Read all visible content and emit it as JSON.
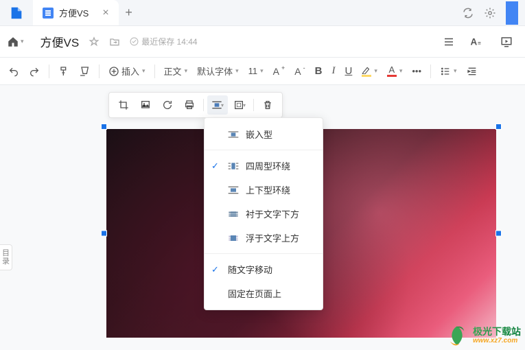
{
  "tab": {
    "title": "方便VS"
  },
  "header": {
    "doc_title": "方便VS",
    "save_status": "最近保存 14:44"
  },
  "toolbar": {
    "insert_label": "插入",
    "style_label": "正文",
    "font_label": "默认字体",
    "font_size": "11",
    "more": "•••"
  },
  "sidebar": {
    "outline": "目录"
  },
  "wrap_menu": {
    "items": [
      {
        "label": "嵌入型",
        "checked": false,
        "icon": "inline"
      },
      {
        "label": "四周型环绕",
        "checked": true,
        "icon": "square"
      },
      {
        "label": "上下型环绕",
        "checked": false,
        "icon": "topbottom"
      },
      {
        "label": "衬于文字下方",
        "checked": false,
        "icon": "behind"
      },
      {
        "label": "浮于文字上方",
        "checked": false,
        "icon": "infront"
      }
    ],
    "move_with_text": "随文字移动",
    "fix_on_page": "固定在页面上"
  },
  "watermark": {
    "cn": "极光下载站",
    "en": "www.xz7.com"
  }
}
